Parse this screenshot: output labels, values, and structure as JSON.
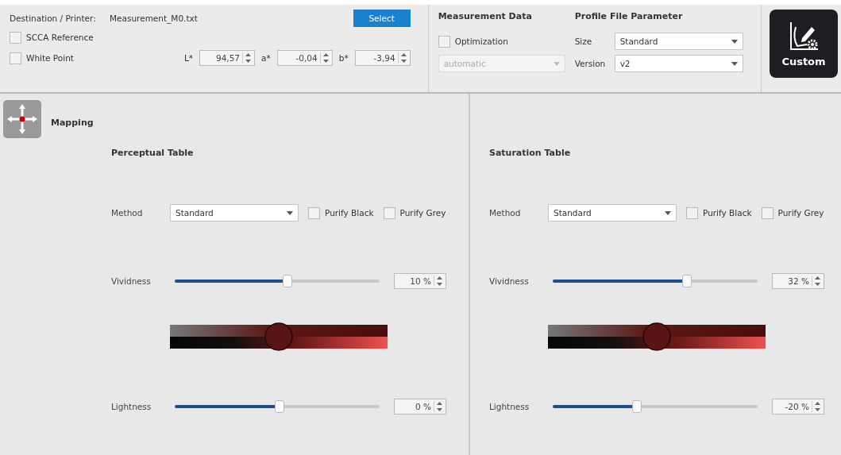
{
  "destination": {
    "label": "Destination / Printer:",
    "file": "Measurement_M0.txt",
    "button": "Select"
  },
  "checks": [
    {
      "label": "SCCA Reference",
      "checked": false
    },
    {
      "label": "White Point",
      "checked": false
    }
  ],
  "white_point": [
    {
      "label": "L*",
      "value": "94,57"
    },
    {
      "label": "a*",
      "value": "-0,04"
    },
    {
      "label": "b*",
      "value": "-3,94"
    }
  ],
  "measurement_data": {
    "title": "Measurement Data",
    "optimization": {
      "label": "Optimization",
      "checked": false
    },
    "mode": {
      "value": "automatic",
      "disabled": true
    }
  },
  "profile_parameters": {
    "title": "Profile File Parameter",
    "fields": [
      {
        "label": "Size",
        "value": "Standard"
      },
      {
        "label": "Version",
        "value": "v2"
      }
    ]
  },
  "custom_button": "Custom",
  "mapping": {
    "title": "Mapping"
  },
  "tables": [
    {
      "title": "Perceptual Table",
      "method_label": "Method",
      "method": "Standard",
      "options": [
        {
          "label": "Purify Black",
          "checked": false
        },
        {
          "label": "Purify Grey",
          "checked": false
        }
      ],
      "sliders": [
        {
          "label": "Vividness",
          "level": 0.55,
          "reading": "10 %"
        },
        {
          "label": "Lightness",
          "level": 0.51,
          "reading": "0 %"
        }
      ]
    },
    {
      "title": "Saturation Table",
      "method_label": "Method",
      "method": "Standard",
      "options": [
        {
          "label": "Purify Black",
          "checked": false
        },
        {
          "label": "Purify Grey",
          "checked": false
        }
      ],
      "sliders": [
        {
          "label": "Vividness",
          "level": 0.655,
          "reading": "32 %"
        },
        {
          "label": "Lightness",
          "level": 0.41,
          "reading": "-20 %"
        }
      ]
    }
  ]
}
